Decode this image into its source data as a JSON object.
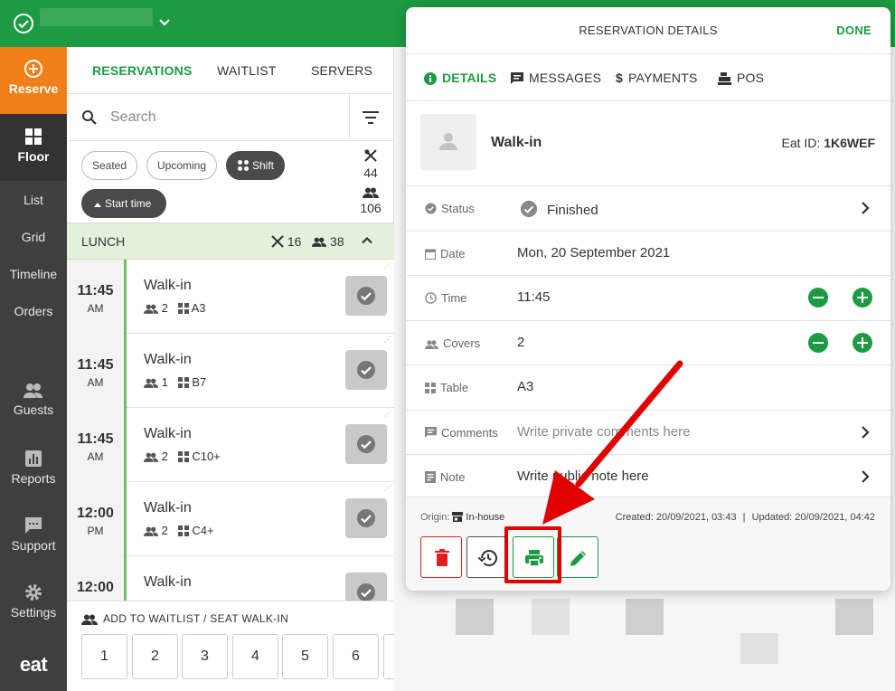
{
  "topbar": {
    "icon": "check-circle-icon"
  },
  "sidebar": {
    "reserve": "Reserve",
    "floor": "Floor",
    "list": "List",
    "grid": "Grid",
    "timeline": "Timeline",
    "orders": "Orders",
    "guests": "Guests",
    "reports": "Reports",
    "support": "Support",
    "settings": "Settings",
    "logo": "eat"
  },
  "tabs": {
    "reservations": "RESERVATIONS",
    "waitlist": "WAITLIST",
    "servers": "SERVERS"
  },
  "search": {
    "placeholder": "Search"
  },
  "chips": {
    "seated": "Seated",
    "upcoming": "Upcoming",
    "shift": "Shift",
    "start_time": "Start time"
  },
  "counts": {
    "reservations": "44",
    "covers": "106"
  },
  "section": {
    "label": "LUNCH",
    "reservations": "16",
    "covers": "38"
  },
  "rows": [
    {
      "hh": "11:45",
      "ap": "AM",
      "name": "Walk-in",
      "covers": "2",
      "table": "A3"
    },
    {
      "hh": "11:45",
      "ap": "AM",
      "name": "Walk-in",
      "covers": "1",
      "table": "B7"
    },
    {
      "hh": "11:45",
      "ap": "AM",
      "name": "Walk-in",
      "covers": "2",
      "table": "C10+"
    },
    {
      "hh": "12:00",
      "ap": "PM",
      "name": "Walk-in",
      "covers": "2",
      "table": "C4+"
    },
    {
      "hh": "12:00",
      "ap": "",
      "name": "Walk-in",
      "covers": "",
      "table": ""
    }
  ],
  "bottom": {
    "title": "ADD TO WAITLIST / SEAT WALK-IN",
    "keys": [
      "1",
      "2",
      "3",
      "4",
      "5",
      "6"
    ]
  },
  "modal": {
    "title": "RESERVATION DETAILS",
    "done": "DONE",
    "tabs": {
      "details": "DETAILS",
      "messages": "MESSAGES",
      "payments": "PAYMENTS",
      "pos": "POS"
    },
    "guest_name": "Walk-in",
    "eat_id_label": "Eat ID:",
    "eat_id": "1K6WEF",
    "fields": {
      "status_label": "Status",
      "status_value": "Finished",
      "date_label": "Date",
      "date_value": "Mon, 20 September 2021",
      "time_label": "Time",
      "time_value": "11:45",
      "covers_label": "Covers",
      "covers_value": "2",
      "table_label": "Table",
      "table_value": "A3",
      "comments_label": "Comments",
      "comments_placeholder": "Write private comments here",
      "note_label": "Note",
      "note_placeholder": "Write public note here"
    },
    "footer": {
      "origin_label": "Origin:",
      "origin_value": "In-house",
      "created": "Created: 20/09/2021, 03:43",
      "separator": "|",
      "updated": "Updated: 20/09/2021, 04:42"
    }
  },
  "colors": {
    "brand_green": "#1d9b43",
    "reserve_orange": "#f07f1a",
    "sidebar_dark": "#3f3f3f",
    "annotation_red": "#e00000",
    "delete_red": "#e02020"
  }
}
